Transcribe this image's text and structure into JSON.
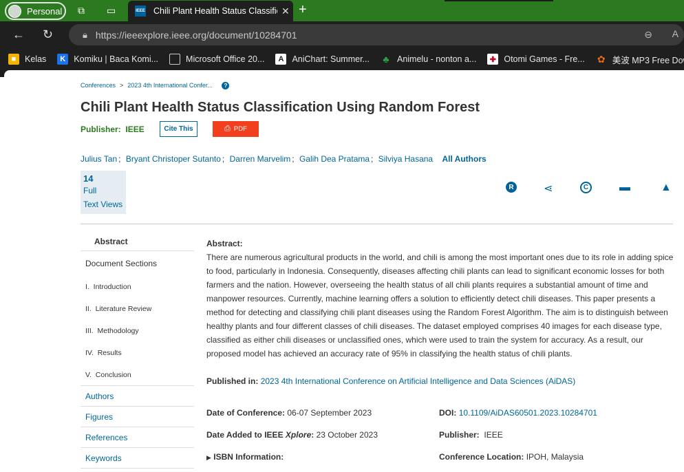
{
  "browser": {
    "profile_label": "Personal",
    "tab_title": "Chili Plant Health Status Classification Using Random Forest",
    "tab_favicon": "IEEE",
    "url": "https://ieeexplore.ieee.org/document/10284701",
    "bookmarks": [
      {
        "label": "Kelas",
        "icon": "classroom-icon",
        "color": "#f4b400"
      },
      {
        "label": "Komiku | Baca Komi...",
        "icon": "k-icon",
        "color": "#1a73e8"
      },
      {
        "label": "Microsoft Office 20...",
        "icon": "page-icon",
        "color": "#1f1f1f"
      },
      {
        "label": "AniChart: Summer...",
        "icon": "a-icon",
        "color": "#ffffff"
      },
      {
        "label": "Animelu - nonton a...",
        "icon": "leaf-icon",
        "color": "#2ea043"
      },
      {
        "label": "Otomi Games - Fre...",
        "icon": "game-icon",
        "color": "#d0021b"
      },
      {
        "label": "美波 MP3 Free Dow...",
        "icon": "paw-icon",
        "color": "#e86a1a"
      }
    ]
  },
  "breadcrumb": {
    "items": [
      "Conferences",
      "2023 4th International Confer..."
    ]
  },
  "article": {
    "title": "Chili Plant Health Status Classification Using Random Forest",
    "publisher_label": "Publisher:",
    "publisher_value": "IEEE",
    "cite_label": "Cite This",
    "pdf_label": "PDF",
    "authors": [
      "Julius Tan",
      "Bryant Christoper Sutanto",
      "Darren Marvelim",
      "Galih Dea Pratama",
      "Silviya Hasana"
    ],
    "all_authors_label": "All Authors",
    "metrics": {
      "count": "14",
      "line1": "Full",
      "line2": "Text Views"
    }
  },
  "sidebar": {
    "abstract_label": "Abstract",
    "sections_label": "Document Sections",
    "sections": [
      "I.  Introduction",
      "II.  Literature Review",
      "III.  Methodology",
      "IV.  Results",
      "V.  Conclusion"
    ],
    "links": [
      "Authors",
      "Figures",
      "References",
      "Keywords"
    ]
  },
  "abstract": {
    "heading": "Abstract:",
    "text": "There are numerous agricultural products in the world, and chili is among the most important ones due to its role in adding spice to food, particularly in Indonesia. Consequently, diseases affecting chili plants can lead to significant economic losses for both farmers and the nation. However, overseeing the health status of all chili plants requires a substantial amount of time and manpower resources. Currently, machine learning offers a solution to efficiently detect chili diseases. This paper presents a method for detecting and classifying chili plant diseases using the Random Forest Algorithm. The aim is to distinguish between healthy plants and four different classes of chili diseases. The dataset employed comprises 40 images for each disease type, classified as either chili diseases or unclassified ones, which were used to train the system for accuracy. As a result, our proposed model has achieved an accuracy rate of 95% in classifying the health status of chili plants."
  },
  "published_in": {
    "label": "Published in:",
    "value": "2023 4th International Conference on Artificial Intelligence and Data Sciences (AiDAS)"
  },
  "details": {
    "date_conf_label": "Date of Conference:",
    "date_conf_value": "06-07 September 2023",
    "date_added_label": "Date Added to IEEE ",
    "date_added_italic": "Xplore",
    "date_added_colon": ":",
    "date_added_value": "23 October 2023",
    "isbn_label": "ISBN Information:",
    "doi_label": "DOI:",
    "doi_value": "10.1109/AiDAS60501.2023.10284701",
    "publisher_label": "Publisher:",
    "publisher_value": "IEEE",
    "location_label": "Conference Location:",
    "location_value": "IPOH, Malaysia"
  }
}
